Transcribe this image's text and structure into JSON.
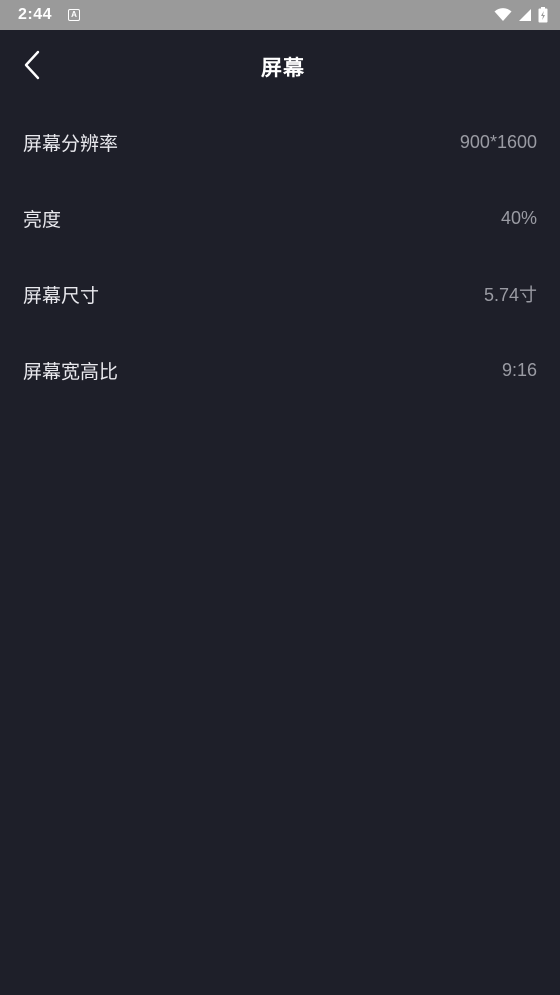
{
  "status_bar": {
    "time": "2:44",
    "notification_glyph": "A",
    "icons": [
      "wifi-icon",
      "cell-signal-icon",
      "battery-charging-icon"
    ]
  },
  "header": {
    "title": "屏幕",
    "back_icon": "chevron-left-icon"
  },
  "settings": {
    "items": [
      {
        "label": "屏幕分辨率",
        "value": "900*1600"
      },
      {
        "label": "亮度",
        "value": "40%"
      },
      {
        "label": "屏幕尺寸",
        "value": "5.74寸"
      },
      {
        "label": "屏幕宽高比",
        "value": "9:16"
      }
    ]
  },
  "colors": {
    "background": "#1e1f29",
    "status_bar": "#9a9a9a",
    "label_text": "#e9e9ee",
    "value_text": "#9a9ba3"
  }
}
